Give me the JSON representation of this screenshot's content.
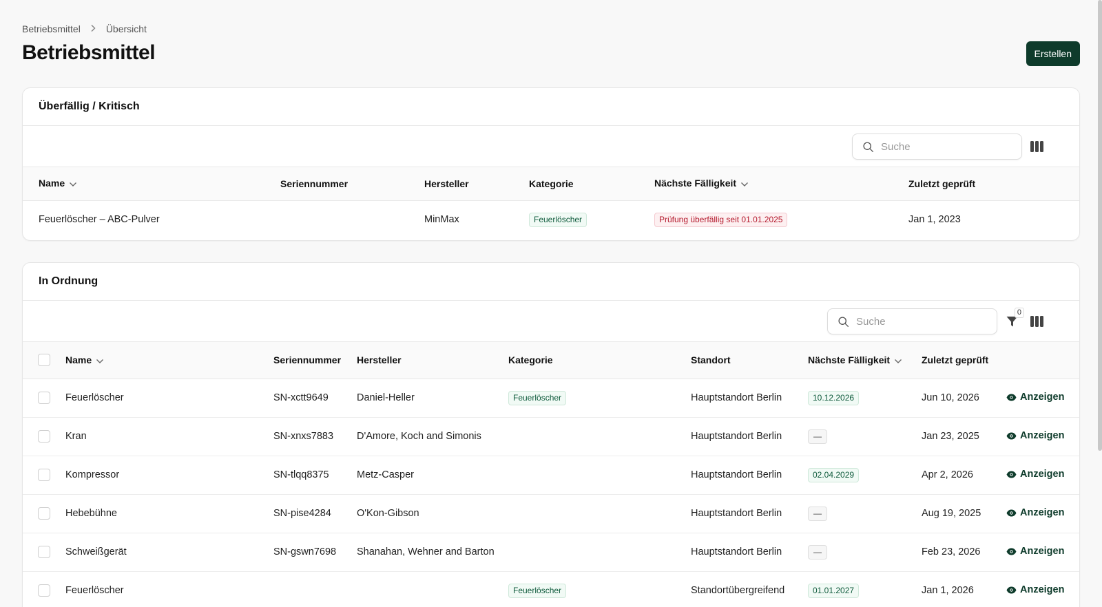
{
  "breadcrumb": {
    "parent": "Betriebsmittel",
    "current": "Übersicht"
  },
  "page": {
    "title": "Betriebsmittel",
    "create_label": "Erstellen"
  },
  "colors": {
    "accent": "#0e3b2b",
    "success_badge": "#0e5a3b",
    "danger_badge": "#b4182c"
  },
  "overdue_section": {
    "title": "Überfällig / Kritisch",
    "search_placeholder": "Suche",
    "columns": {
      "name": "Name",
      "serial": "Seriennummer",
      "manufacturer": "Hersteller",
      "category": "Kategorie",
      "next_due": "Nächste Fälligkeit",
      "last_checked": "Zuletzt geprüft"
    },
    "rows": [
      {
        "name": "Feuerlöscher – ABC-Pulver",
        "serial": "",
        "manufacturer": "MinMax",
        "category": "Feuerlöscher",
        "next_due": "Prüfung überfällig seit 01.01.2025",
        "last_checked": "Jan 1, 2023"
      }
    ]
  },
  "ok_section": {
    "title": "In Ordnung",
    "search_placeholder": "Suche",
    "filter_count": "0",
    "columns": {
      "name": "Name",
      "serial": "Seriennummer",
      "manufacturer": "Hersteller",
      "category": "Kategorie",
      "location": "Standort",
      "next_due": "Nächste Fälligkeit",
      "last_checked": "Zuletzt geprüft"
    },
    "view_label": "Anzeigen",
    "rows": [
      {
        "name": "Feuerlöscher",
        "serial": "SN-xctt9649",
        "manufacturer": "Daniel-Heller",
        "category": "Feuerlöscher",
        "location": "Hauptstandort Berlin",
        "next_due": "10.12.2026",
        "last_checked": "Jun 10, 2026"
      },
      {
        "name": "Kran",
        "serial": "SN-xnxs7883",
        "manufacturer": "D'Amore, Koch and Simonis",
        "category": "",
        "location": "Hauptstandort Berlin",
        "next_due": "—",
        "last_checked": "Jan 23, 2025"
      },
      {
        "name": "Kompressor",
        "serial": "SN-tlqq8375",
        "manufacturer": "Metz-Casper",
        "category": "",
        "location": "Hauptstandort Berlin",
        "next_due": "02.04.2029",
        "last_checked": "Apr 2, 2026"
      },
      {
        "name": "Hebebühne",
        "serial": "SN-pise4284",
        "manufacturer": "O'Kon-Gibson",
        "category": "",
        "location": "Hauptstandort Berlin",
        "next_due": "—",
        "last_checked": "Aug 19, 2025"
      },
      {
        "name": "Schweißgerät",
        "serial": "SN-gswn7698",
        "manufacturer": "Shanahan, Wehner and Barton",
        "category": "",
        "location": "Hauptstandort Berlin",
        "next_due": "—",
        "last_checked": "Feb 23, 2026"
      },
      {
        "name": "Feuerlöscher",
        "serial": "",
        "manufacturer": "",
        "category": "Feuerlöscher",
        "location": "Standortübergreifend",
        "next_due": "01.01.2027",
        "last_checked": "Jan 1, 2026"
      }
    ]
  }
}
